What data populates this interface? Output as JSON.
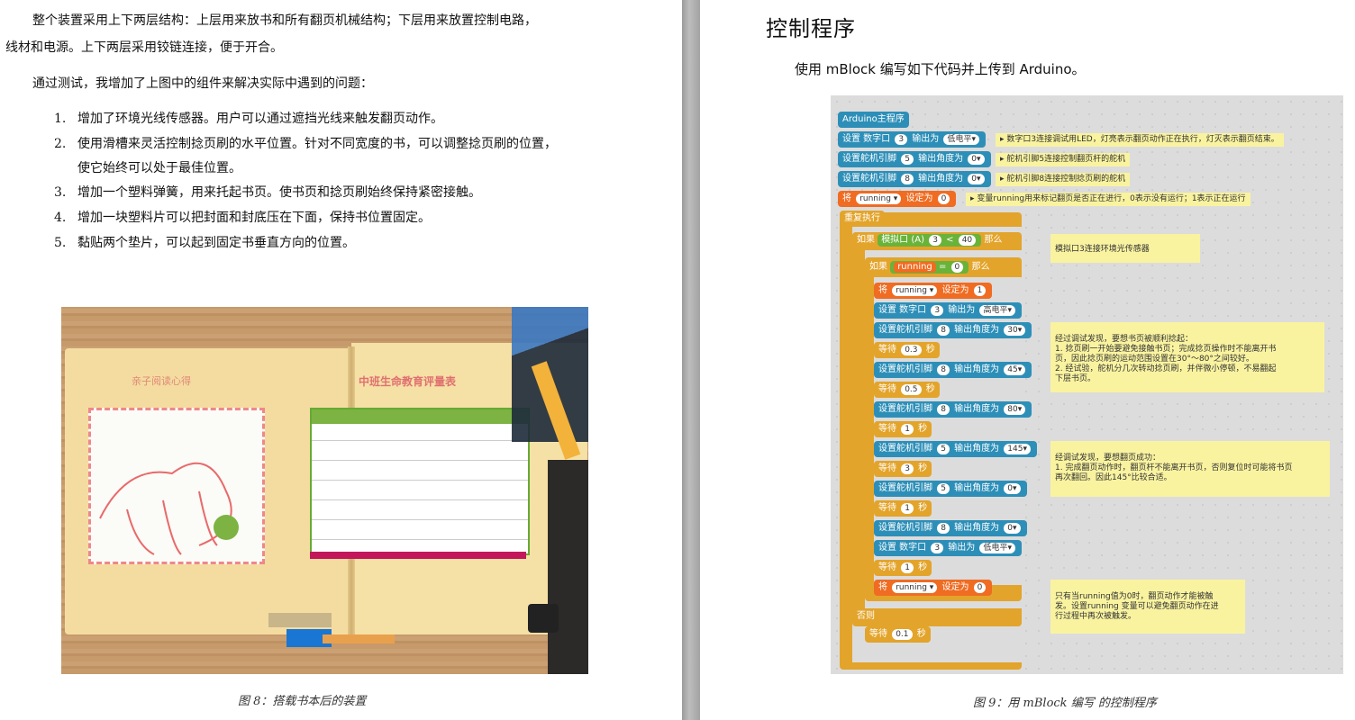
{
  "left_page": {
    "para1_line1": "整个装置采用上下两层结构：上层用来放书和所有翻页机械结构；下层用来放置控制电路，",
    "para1_line2": "线材和电源。上下两层采用铰链连接，便于开合。",
    "para2": "通过测试，我增加了上图中的组件来解决实际中遇到的问题：",
    "list": [
      {
        "num": "1.",
        "line1": "增加了环境光线传感器。用户可以通过遮挡光线来触发翻页动作。",
        "line2": ""
      },
      {
        "num": "2.",
        "line1": "使用滑槽来灵活控制捻页刷的水平位置。针对不同宽度的书，可以调整捻页刷的位置，",
        "line2": "使它始终可以处于最佳位置。"
      },
      {
        "num": "3.",
        "line1": "增加一个塑料弹簧，用来托起书页。使书页和捻页刷始终保持紧密接触。",
        "line2": ""
      },
      {
        "num": "4.",
        "line1": "增加一块塑料片可以把封面和封底压在下面，保持书位置固定。",
        "line2": ""
      },
      {
        "num": "5.",
        "line1": "黏贴两个垫片，可以起到固定书垂直方向的位置。",
        "line2": ""
      }
    ],
    "photo_text_left": "亲子阅读心得",
    "photo_text_right": "中班生命教育评量表",
    "caption": "图 8：搭载书本后的装置"
  },
  "right_page": {
    "heading": "控制程序",
    "intro": "使用 mBlock 编写如下代码并上传到 Arduino。",
    "caption": "图 9：用 mBlock 编写 的控制程序",
    "blocks": {
      "hat": "Arduino主程序",
      "b1": "设置 数字口",
      "b1_pin": "3",
      "b1_mid": "输出为",
      "b1_val": "低电平▾",
      "b1_cmt": "▸ 数字口3连接调试用LED，灯亮表示翻页动作正在执行，灯灭表示翻页结束。",
      "b2": "设置舵机引脚",
      "b2_pin": "5",
      "b2_mid": "输出角度为",
      "b2_val": "0▾",
      "b2_cmt": "▸ 舵机引脚5连接控制翻页杆的舵机",
      "b3": "设置舵机引脚",
      "b3_pin": "8",
      "b3_mid": "输出角度为",
      "b3_val": "0▾",
      "b3_cmt": "▸ 舵机引脚8连接控制捻页刷的舵机",
      "b4": "将",
      "b4_var": "running ▾",
      "b4_mid": "设定为",
      "b4_val": "0",
      "b4_cmt": "▸ 变量running用来标记翻页是否正在进行，0表示没有运行；1表示正在运行",
      "loop": "重复执行",
      "if1": "如果",
      "if1_cond": "模拟口 (A)",
      "if1_pin": "3",
      "if1_op": "<",
      "if1_val": "40",
      "if1_then": "那么",
      "if1_cmt": "模拟口3连接环境光传感器",
      "if2": "如果",
      "if2_var": "running",
      "if2_op": "=",
      "if2_val": "0",
      "if2_then": "那么",
      "s1": "将",
      "s1_var": "running ▾",
      "s1_mid": "设定为",
      "s1_val": "1",
      "s2": "设置 数字口",
      "s2_pin": "3",
      "s2_mid": "输出为",
      "s2_val": "高电平▾",
      "s3": "设置舵机引脚",
      "s3_pin": "8",
      "s3_mid": "输出角度为",
      "s3_val": "30▾",
      "w1": "等待",
      "w1_val": "0.3",
      "w1_unit": "秒",
      "s4": "设置舵机引脚",
      "s4_pin": "8",
      "s4_mid": "输出角度为",
      "s4_val": "45▾",
      "w2": "等待",
      "w2_val": "0.5",
      "w2_unit": "秒",
      "s5": "设置舵机引脚",
      "s5_pin": "8",
      "s5_mid": "输出角度为",
      "s5_val": "80▾",
      "w3": "等待",
      "w3_val": "1",
      "w3_unit": "秒",
      "s6": "设置舵机引脚",
      "s6_pin": "5",
      "s6_mid": "输出角度为",
      "s6_val": "145▾",
      "w4": "等待",
      "w4_val": "3",
      "w4_unit": "秒",
      "s7": "设置舵机引脚",
      "s7_pin": "5",
      "s7_mid": "输出角度为",
      "s7_val": "0▾",
      "w5": "等待",
      "w5_val": "1",
      "w5_unit": "秒",
      "s8": "设置舵机引脚",
      "s8_pin": "8",
      "s8_mid": "输出角度为",
      "s8_val": "0▾",
      "s9": "设置 数字口",
      "s9_pin": "3",
      "s9_mid": "输出为",
      "s9_val": "低电平▾",
      "w6": "等待",
      "w6_val": "1",
      "w6_unit": "秒",
      "s10": "将",
      "s10_var": "running ▾",
      "s10_mid": "设定为",
      "s10_val": "0",
      "else": "否则",
      "w7": "等待",
      "w7_val": "0.1",
      "w7_unit": "秒",
      "cmt2_l1": "经过调试发现，要想书页被顺利捻起：",
      "cmt2_l2": "1. 捻页刷一开始要避免接触书页；完成捻页操作时不能离开书",
      "cmt2_l3": "页，因此捻页刷的运动范围设置在30°～80°之间较好。",
      "cmt2_l4": "2. 经试验，舵机分几次转动捻页刷，并伴微小停顿，不易翻起",
      "cmt2_l5": "下层书页。",
      "cmt3_l1": "经调试发现，要想翻页成功：",
      "cmt3_l2": "1. 完成翻页动作时，翻页杆不能离开书页，否则复位时可能将书页",
      "cmt3_l3": "再次翻回。因此145°比较合适。",
      "cmt4_l1": "只有当running值为0时，翻页动作才能被触",
      "cmt4_l2": "发。设置running 变量可以避免翻页动作在进",
      "cmt4_l3": "行过程中再次被触发。"
    }
  }
}
